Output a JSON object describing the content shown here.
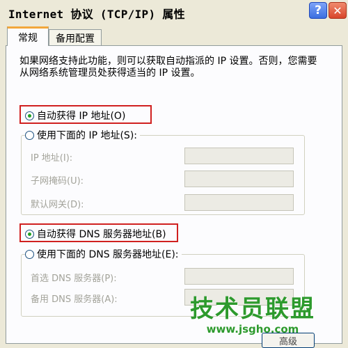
{
  "window": {
    "title": "Internet 协议 (TCP/IP) 属性",
    "help_label": "?",
    "close_label": "✕"
  },
  "tabs": [
    {
      "label": "常规",
      "active": true
    },
    {
      "label": "备用配置",
      "active": false
    }
  ],
  "description": "如果网络支持此功能，则可以获取自动指派的 IP 设置。否则，您需要从网络系统管理员处获得适当的 IP 设置。",
  "ip": {
    "auto_label": "自动获得 IP 地址(O)",
    "manual_label": "使用下面的 IP 地址(S):",
    "fields": [
      {
        "label": "IP 地址(I):",
        "value": ""
      },
      {
        "label": "子网掩码(U):",
        "value": ""
      },
      {
        "label": "默认网关(D):",
        "value": ""
      }
    ]
  },
  "dns": {
    "auto_label": "自动获得 DNS 服务器地址(B)",
    "manual_label": "使用下面的 DNS 服务器地址(E):",
    "fields": [
      {
        "label": "首选 DNS 服务器(P):",
        "value": ""
      },
      {
        "label": "备用 DNS 服务器(A):",
        "value": ""
      }
    ]
  },
  "watermark": {
    "title": "技术员联盟",
    "url": "www.jsgho.com"
  },
  "bottom_button": "高级"
}
